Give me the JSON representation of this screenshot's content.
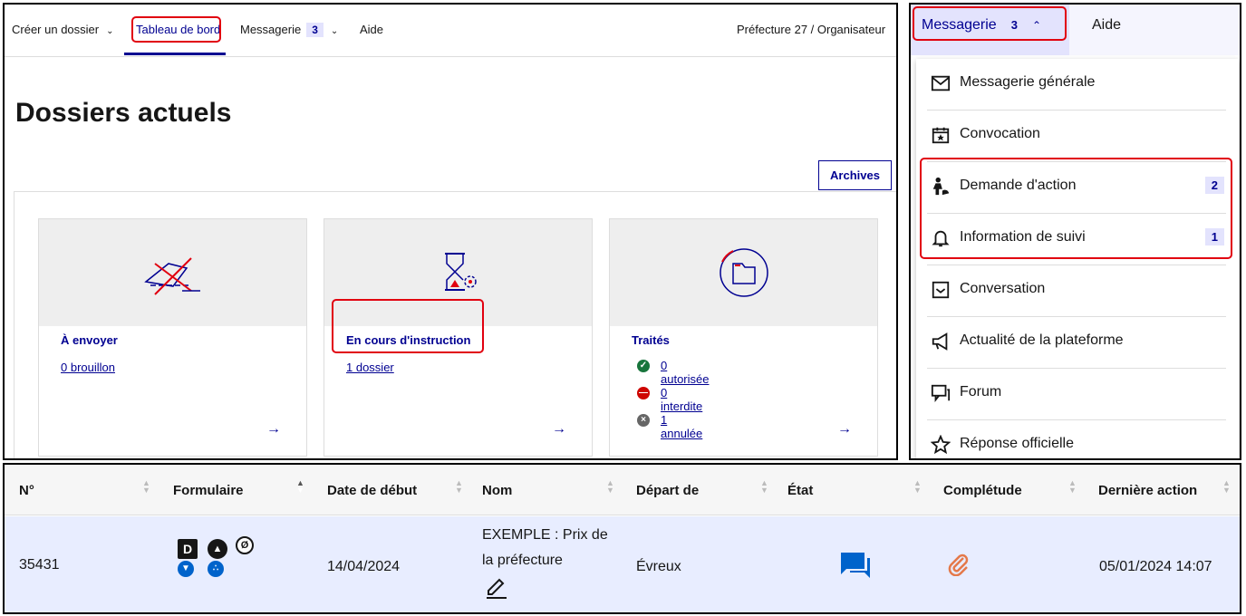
{
  "nav": {
    "create_folder": "Créer un dossier",
    "dashboard": "Tableau de bord",
    "messaging": "Messagerie",
    "messaging_count": "3",
    "help": "Aide",
    "user_context": "Préfecture 27 / Organisateur"
  },
  "page": {
    "title": "Dossiers actuels",
    "archives_button": "Archives"
  },
  "cards": {
    "to_send": {
      "title": "À envoyer",
      "link": "0 brouillon"
    },
    "in_progress": {
      "title": "En cours d'instruction",
      "link": "1 dossier"
    },
    "processed": {
      "title": "Traités",
      "authorized": "0 autorisée",
      "forbidden": "0 interdite",
      "cancelled": "1 annulée"
    }
  },
  "menu": {
    "header_label": "Messagerie",
    "header_count": "3",
    "help": "Aide",
    "items": [
      {
        "label": "Messagerie générale",
        "icon": "envelope-icon"
      },
      {
        "label": "Convocation",
        "icon": "calendar-star-icon"
      },
      {
        "label": "Demande d'action",
        "icon": "worker-icon",
        "count": "2"
      },
      {
        "label": "Information de suivi",
        "icon": "bell-icon",
        "count": "1"
      },
      {
        "label": "Conversation",
        "icon": "chat-check-icon"
      },
      {
        "label": "Actualité de la plateforme",
        "icon": "megaphone-icon"
      },
      {
        "label": "Forum",
        "icon": "forum-icon"
      },
      {
        "label": "Réponse officielle",
        "icon": "star-icon"
      }
    ]
  },
  "table": {
    "headers": [
      "N°",
      "Formulaire",
      "Date de début",
      "Nom",
      "Départ de",
      "État",
      "Complétude",
      "Dernière action"
    ],
    "row": {
      "number": "35431",
      "start_date": "14/04/2024",
      "name_line1": "EXEMPLE : Prix de",
      "name_line2": "la préfecture",
      "departure": "Évreux",
      "last_action": "05/01/2024 14:07"
    }
  },
  "colors": {
    "primary": "#000091",
    "highlight_red": "#e1000f",
    "badge_bg": "#e3e3fd",
    "row_bg": "#e8edff",
    "success": "#18753c",
    "danger": "#ce0500"
  }
}
